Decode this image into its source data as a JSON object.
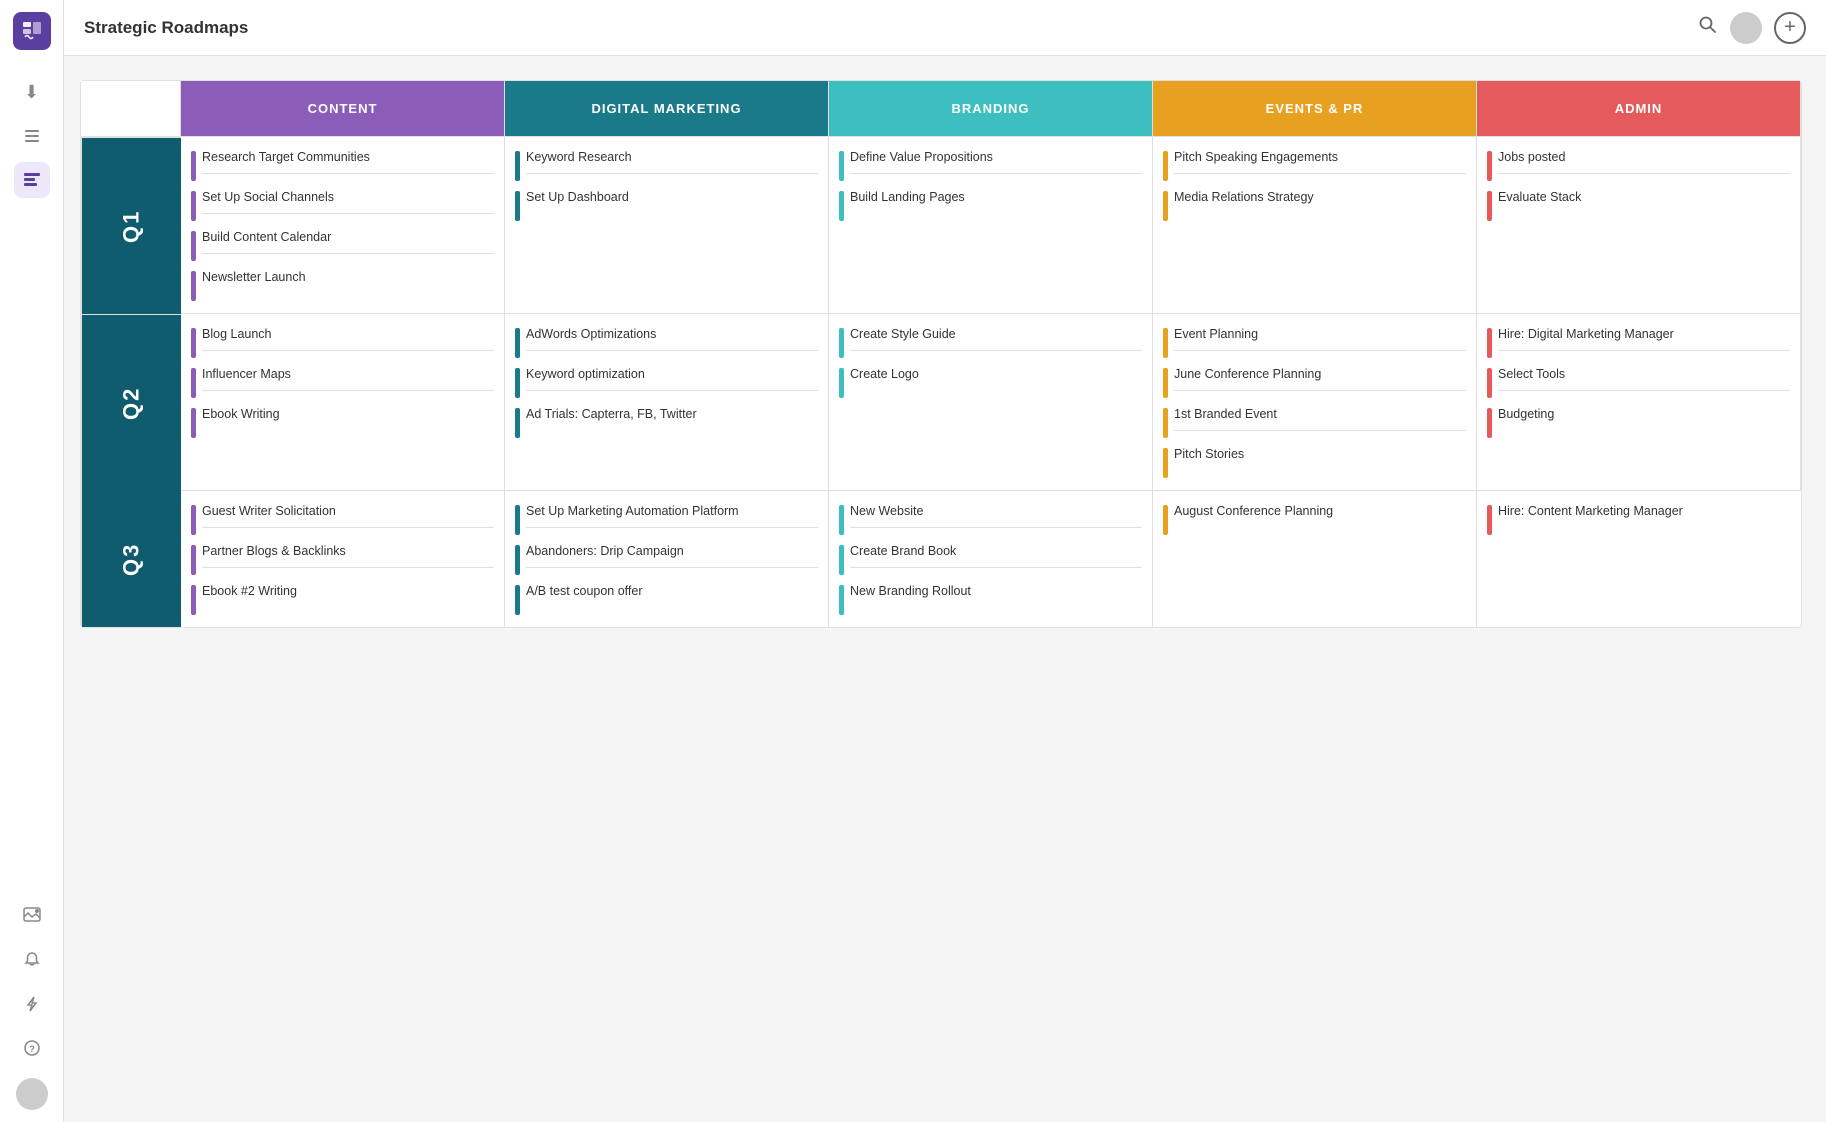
{
  "app": {
    "title": "Strategic Roadmaps",
    "logo_alt": "app-logo"
  },
  "sidebar": {
    "icons": [
      {
        "name": "download-icon",
        "symbol": "⬇",
        "active": false
      },
      {
        "name": "list-icon",
        "symbol": "≡",
        "active": false
      },
      {
        "name": "roadmap-icon",
        "symbol": "☰",
        "active": true
      },
      {
        "name": "add-image-icon",
        "symbol": "🖼",
        "active": false
      },
      {
        "name": "bell-icon",
        "symbol": "🔔",
        "active": false
      },
      {
        "name": "bolt-icon",
        "symbol": "⚡",
        "active": false
      },
      {
        "name": "help-icon",
        "symbol": "?",
        "active": false
      }
    ]
  },
  "header": {
    "title": "Strategic Roadmaps"
  },
  "columns": [
    {
      "id": "content",
      "label": "CONTENT",
      "color": "#8b5cb8"
    },
    {
      "id": "digital",
      "label": "DIGITAL MARKETING",
      "color": "#1a7a8a"
    },
    {
      "id": "branding",
      "label": "BRANDING",
      "color": "#3dbfbf"
    },
    {
      "id": "events",
      "label": "EVENTS & PR",
      "color": "#e8a020"
    },
    {
      "id": "admin",
      "label": "ADMIN",
      "color": "#e55a5a"
    }
  ],
  "rows": [
    {
      "id": "q1",
      "label": "Q1",
      "cells": {
        "content": [
          {
            "text": "Research Target Communities"
          },
          {
            "text": "Set Up Social Channels"
          },
          {
            "text": "Build Content Calendar"
          },
          {
            "text": "Newsletter Launch"
          }
        ],
        "digital": [
          {
            "text": "Keyword Research"
          },
          {
            "text": "Set Up Dashboard"
          }
        ],
        "branding": [
          {
            "text": "Define Value Propositions"
          },
          {
            "text": "Build Landing Pages"
          }
        ],
        "events": [
          {
            "text": "Pitch Speaking Engagements"
          },
          {
            "text": "Media Relations Strategy"
          }
        ],
        "admin": [
          {
            "text": "Jobs posted"
          },
          {
            "text": "Evaluate Stack"
          }
        ]
      }
    },
    {
      "id": "q2",
      "label": "Q2",
      "cells": {
        "content": [
          {
            "text": "Blog Launch"
          },
          {
            "text": "Influencer Maps"
          },
          {
            "text": "Ebook Writing"
          }
        ],
        "digital": [
          {
            "text": "AdWords Optimizations"
          },
          {
            "text": "Keyword optimization"
          },
          {
            "text": "Ad Trials: Capterra, FB, Twitter"
          }
        ],
        "branding": [
          {
            "text": "Create Style Guide"
          },
          {
            "text": "Create Logo"
          }
        ],
        "events": [
          {
            "text": "Event Planning"
          },
          {
            "text": "June Conference Planning"
          },
          {
            "text": "1st Branded Event"
          },
          {
            "text": "Pitch Stories"
          }
        ],
        "admin": [
          {
            "text": "Hire: Digital Marketing Manager"
          },
          {
            "text": "Select Tools"
          },
          {
            "text": "Budgeting"
          }
        ]
      }
    },
    {
      "id": "q3",
      "label": "Q3",
      "cells": {
        "content": [
          {
            "text": "Guest Writer Solicitation"
          },
          {
            "text": "Partner Blogs & Backlinks"
          },
          {
            "text": "Ebook #2 Writing"
          }
        ],
        "digital": [
          {
            "text": "Set Up Marketing Automation Platform"
          },
          {
            "text": "Abandoners: Drip Campaign"
          },
          {
            "text": "A/B test coupon offer"
          }
        ],
        "branding": [
          {
            "text": "New Website"
          },
          {
            "text": "Create Brand Book"
          },
          {
            "text": "New Branding Rollout"
          }
        ],
        "events": [
          {
            "text": "August Conference Planning"
          }
        ],
        "admin": [
          {
            "text": "Hire: Content Marketing Manager"
          }
        ]
      }
    }
  ],
  "colors": {
    "content_bar": "#8b5cb8",
    "digital_bar": "#1a7a8a",
    "branding_bar": "#3dbfbf",
    "events_bar": "#e8a020",
    "admin_bar": "#e55a5a",
    "row_bg": "#0e5c6e"
  }
}
